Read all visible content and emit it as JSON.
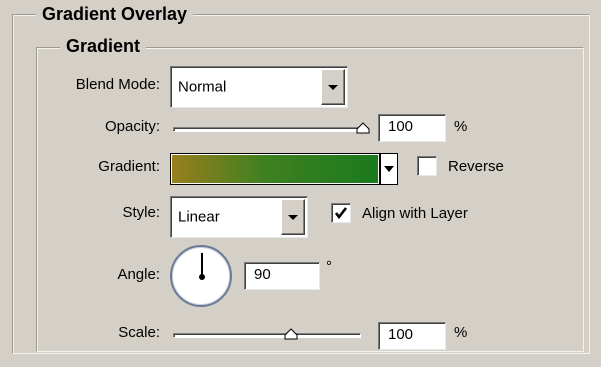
{
  "panel": {
    "title": "Gradient Overlay",
    "group_title": "Gradient"
  },
  "blend_mode": {
    "label": "Blend Mode:",
    "value": "Normal"
  },
  "opacity": {
    "label": "Opacity:",
    "value": "100",
    "unit": "%",
    "slider_fraction": 1.0
  },
  "gradient": {
    "label": "Gradient:",
    "colors": [
      "#9a7e1e",
      "#3f8020",
      "#1a7a1e"
    ],
    "reverse_label": "Reverse",
    "reverse_checked": false
  },
  "style": {
    "label": "Style:",
    "value": "Linear",
    "align_label": "Align with Layer",
    "align_checked": true
  },
  "angle": {
    "label": "Angle:",
    "value": "90",
    "unit": "°"
  },
  "scale": {
    "label": "Scale:",
    "value": "100",
    "unit": "%",
    "slider_fraction": 0.64
  },
  "icons": [
    "dropdown-arrow-icon",
    "slider-thumb-icon",
    "checkmark-icon",
    "angle-dial-icon"
  ]
}
